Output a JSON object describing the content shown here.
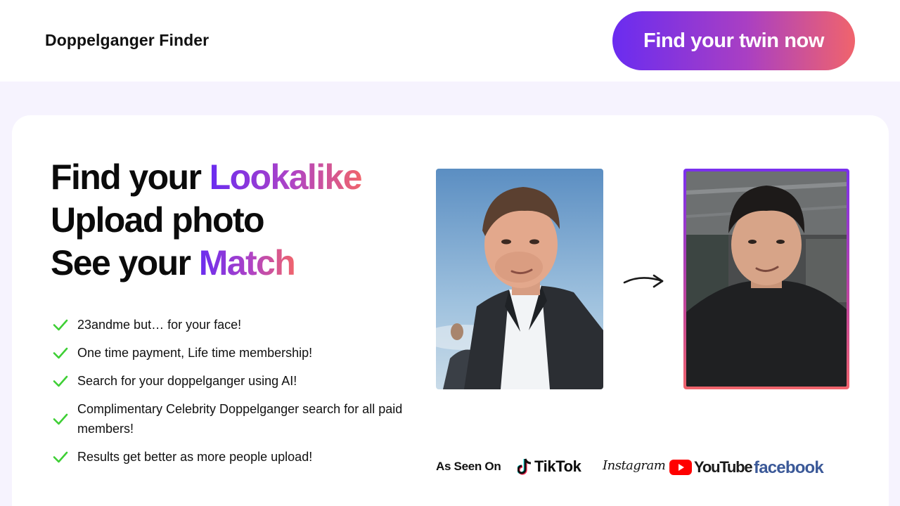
{
  "header": {
    "brand": "Doppelganger Finder",
    "cta_label": "Find your twin now"
  },
  "hero": {
    "line1_prefix": "Find your ",
    "line1_highlight": "Lookalike",
    "line2": "Upload photo",
    "line3_prefix": "See your ",
    "line3_highlight": "Match"
  },
  "features": [
    "23andme but… for your face!",
    "One time payment, Life time membership!",
    "Search for your doppelganger using AI!",
    "Complimentary Celebrity Doppelganger search for all paid members!",
    "Results get better as more people upload!"
  ],
  "comparison": {
    "left_image_icon": "celebrity-photo",
    "right_image_icon": "lookalike-match-photo",
    "arrow_icon": "arrow-right-icon"
  },
  "as_seen_on": {
    "label": "As Seen On",
    "logos": {
      "tiktok": "TikTok",
      "instagram": "Instagram",
      "youtube": "YouTube",
      "facebook": "facebook"
    }
  },
  "colors": {
    "accent_start": "#6a2cf0",
    "accent_mid": "#b044c4",
    "accent_end": "#f0646c",
    "check": "#3ecf35",
    "page_bg": "#f6f3fe"
  }
}
